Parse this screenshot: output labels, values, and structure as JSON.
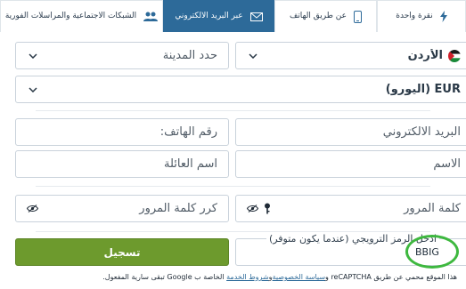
{
  "tabs": [
    {
      "label": "الشبكات الاجتماعية والمراسلات الفورية",
      "icon": "users-icon",
      "active": false
    },
    {
      "label": "عبر البريد الالكتروني",
      "icon": "envelope-icon",
      "active": true
    },
    {
      "label": "عن طريق الهاتف",
      "icon": "phone-icon",
      "active": false
    },
    {
      "label": "نقرة واحدة",
      "icon": "lightning-icon",
      "active": false
    }
  ],
  "form": {
    "country": {
      "value": "الأردن",
      "icon": "jordan-flag-icon"
    },
    "city": {
      "placeholder": "حدد المدينة"
    },
    "currency": {
      "value": "EUR (اليورو)"
    },
    "email": {
      "placeholder": "البريد الالكتروني"
    },
    "phone": {
      "placeholder": "رقم الهاتف:"
    },
    "first_name": {
      "placeholder": "الاسم"
    },
    "last_name": {
      "placeholder": "اسم العائلة"
    },
    "password": {
      "placeholder": "كلمة المرور"
    },
    "password_repeat": {
      "placeholder": "كرر كلمة المرور"
    },
    "promo": {
      "label": "ادخل الرمز الترويجي (عندما يكون متوفر)",
      "value": "BBIG"
    },
    "register_label": "تسجيل"
  },
  "recaptcha": {
    "prefix": "هذا الموقع محمي عن طريق reCAPTCHA و",
    "privacy_link": "سياسة الخصوصية",
    "and": "و",
    "terms_link": "شروط الخدمة",
    "suffix": " الخاصة ب Google تبقى سارية المفعول."
  },
  "colors": {
    "accent": "#2d6a99",
    "register": "#6d9a2d",
    "highlight": "#3eb83f"
  }
}
